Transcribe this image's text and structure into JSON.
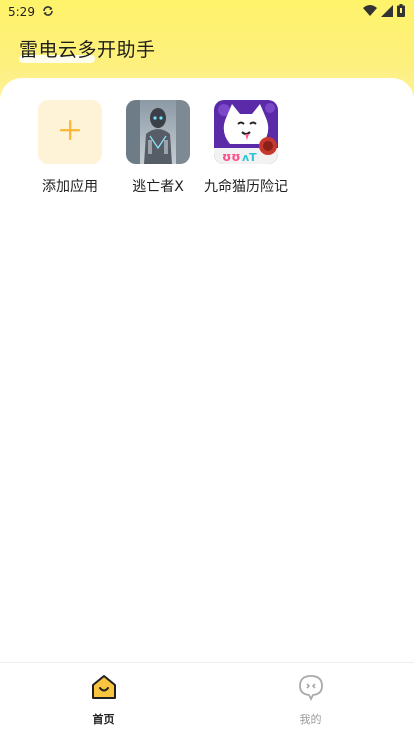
{
  "status_bar": {
    "time": "5:29",
    "icons": [
      "sync-icon",
      "wifi-icon",
      "signal-icon",
      "battery-icon"
    ]
  },
  "header": {
    "title": "雷电云多开助手"
  },
  "apps": [
    {
      "label": "添加应用",
      "icon": "plus-icon",
      "accent": "#f9b93b"
    },
    {
      "label": "逃亡者X",
      "icon": "escape-x-app-icon"
    },
    {
      "label": "九命猫历险记",
      "icon": "nine-lives-cat-app-icon"
    }
  ],
  "bottom_nav": {
    "items": [
      {
        "label": "首页",
        "icon": "home-icon",
        "active": true
      },
      {
        "label": "我的",
        "icon": "profile-chat-icon",
        "active": false
      }
    ]
  },
  "colors": {
    "header_yellow": "#fff36a",
    "accent": "#f9b93b",
    "add_tile_bg": "#fef3d6"
  }
}
